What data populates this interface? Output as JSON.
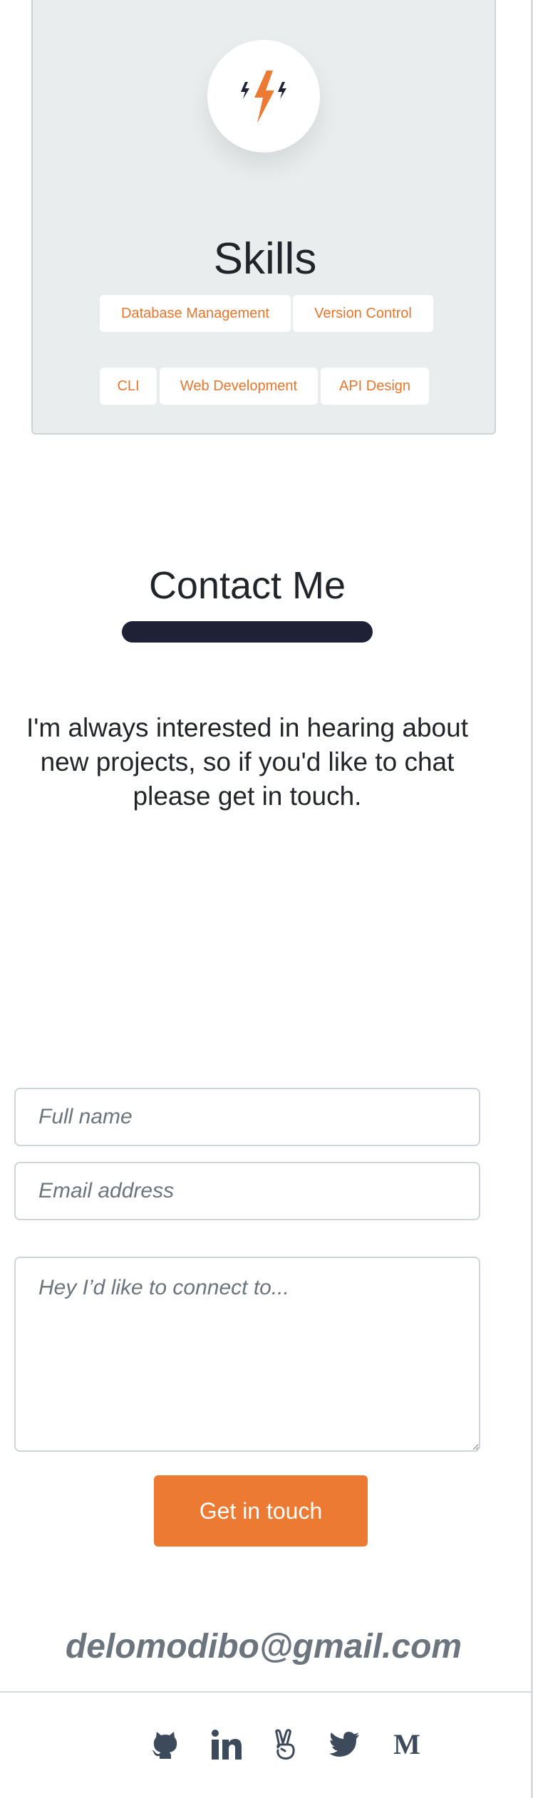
{
  "colors": {
    "accent": "#ec7a32",
    "chip_text": "#e8762d",
    "card_background": "#eaeded",
    "underline": "#1f2136",
    "icon": "#3d4a5c"
  },
  "skills": {
    "icon": "lightning-bolt-icon",
    "title": "Skills",
    "chips": [
      "Database Management",
      "Version Control",
      "CLI",
      "Web Development",
      "API Design"
    ]
  },
  "contact": {
    "title": "Contact Me",
    "intro": "I'm always interested in hearing about new projects, so if you'd like to chat please get in touch.",
    "form": {
      "name_placeholder": "Full name",
      "email_placeholder": "Email address",
      "message_placeholder": "Hey I’d like to connect to...",
      "submit_label": "Get in touch"
    },
    "email": "delomodibo@gmail.com"
  },
  "social": [
    {
      "icon": "github-icon"
    },
    {
      "icon": "linkedin-icon"
    },
    {
      "icon": "angellist-icon"
    },
    {
      "icon": "twitter-icon"
    },
    {
      "icon": "medium-icon",
      "glyph": "M"
    }
  ]
}
